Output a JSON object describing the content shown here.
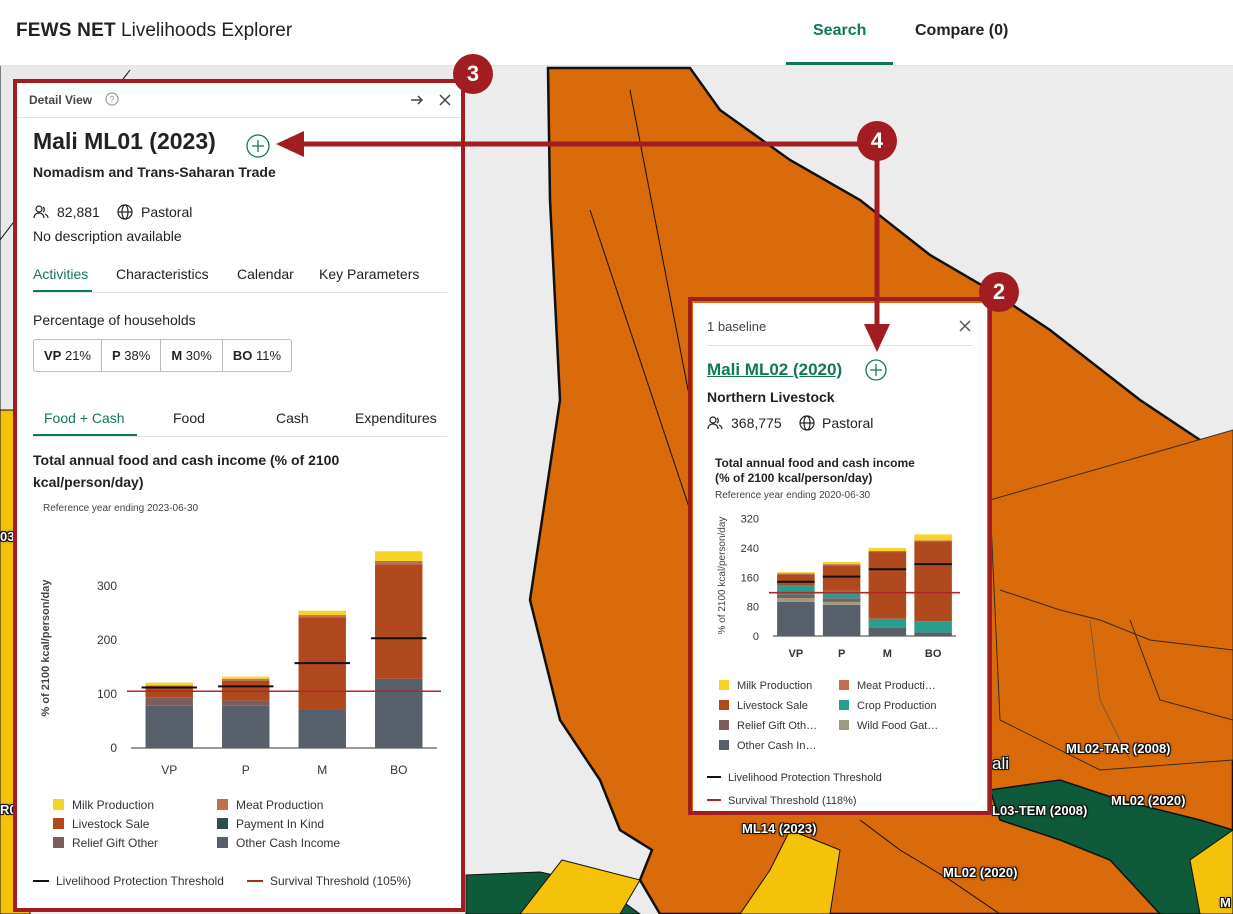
{
  "header": {
    "brand_bold": "FEWS NET",
    "brand_rest": "Livelihoods Explorer",
    "nav_search": "Search",
    "nav_compare": "Compare (0)"
  },
  "colors": {
    "accent_green": "#0f7a4f",
    "annotation_red": "#a11d22",
    "map_orange": "#d96b0b",
    "map_yellow": "#f5c20a",
    "map_dark_green": "#0e5a3a",
    "milk": "#f5d327",
    "livestock_sale": "#b04a1e",
    "meat": "#c07050",
    "crop": "#2a9d8f",
    "relief": "#7d5c5c",
    "wild_food": "#9c9a80",
    "payment_in_kind": "#2f4f4f",
    "other_cash": "#57606a",
    "survival_line": "#b1262b",
    "lpt_line": "#111111"
  },
  "annotations": {
    "badge3": "3",
    "badge4": "4",
    "badge2": "2"
  },
  "map_labels": {
    "ml02_tar": "ML02-TAR (2008)",
    "ml02_a": "ML02 (2020)",
    "ml02_b": "ML02 (2020)",
    "ml03_tem": "L03-TEM (2008)",
    "ml14": "ML14 (2023)",
    "mali": "ali",
    "edge_03": "03",
    "edge_r0": "R0",
    "edge_m": "M"
  },
  "detail": {
    "header_label": "Detail View",
    "title": "Mali ML01 (2023)",
    "subtitle": "Nomadism and Trans-Saharan Trade",
    "population": "82,881",
    "type": "Pastoral",
    "description": "No description available",
    "tabs": [
      "Activities",
      "Characteristics",
      "Calendar",
      "Key Parameters"
    ],
    "pct_label": "Percentage of households",
    "pcts": [
      {
        "group": "VP",
        "value": "21%"
      },
      {
        "group": "P",
        "value": "38%"
      },
      {
        "group": "M",
        "value": "30%"
      },
      {
        "group": "BO",
        "value": "11%"
      }
    ],
    "subtabs": [
      "Food + Cash",
      "Food",
      "Cash",
      "Expenditures"
    ],
    "chart_title": "Total annual food and cash income (% of 2100 kcal/person/day)",
    "ref_year": "Reference year ending 2023-06-30",
    "legend": {
      "milk": "Milk Production",
      "meat": "Meat Production",
      "livestock": "Livestock Sale",
      "pik": "Payment In Kind",
      "relief": "Relief Gift Other",
      "other_cash": "Other Cash Income",
      "lpt": "Livelihood Protection Threshold",
      "survival": "Survival Threshold (105%)"
    }
  },
  "compare": {
    "header_label": "1 baseline",
    "title": "Mali ML02 (2020)",
    "subtitle": "Northern Livestock",
    "population": "368,775",
    "type": "Pastoral",
    "chart_title_1": "Total annual food and cash income",
    "chart_title_2": "(% of 2100 kcal/person/day)",
    "ref_year": "Reference year ending 2020-06-30",
    "legend": {
      "milk": "Milk Production",
      "meat": "Meat Producti…",
      "livestock": "Livestock Sale",
      "crop": "Crop Production",
      "relief": "Relief Gift Oth…",
      "wild": "Wild Food Gat…",
      "other_cash": "Other Cash In…",
      "lpt": "Livelihood Protection Threshold",
      "survival": "Survival Threshold (118%)"
    }
  },
  "chart_data": [
    {
      "type": "bar",
      "stacked": true,
      "title": "Total annual food and cash income (% of 2100 kcal/person/day)",
      "subtitle": "Reference year ending 2023-06-30",
      "ylabel": "% of 2100 kcal/person/day",
      "xlabel": "",
      "categories": [
        "VP",
        "P",
        "M",
        "BO"
      ],
      "ylim": [
        0,
        370
      ],
      "yticks": [
        0,
        100,
        200,
        300
      ],
      "series": [
        {
          "name": "Other Cash Income",
          "color": "#57606a",
          "values": [
            78,
            78,
            72,
            128
          ]
        },
        {
          "name": "Payment In Kind",
          "color": "#2f4f4f",
          "values": [
            0,
            0,
            0,
            0
          ]
        },
        {
          "name": "Relief Gift Other",
          "color": "#7d5c5c",
          "values": [
            16,
            10,
            0,
            0
          ]
        },
        {
          "name": "Livestock Sale",
          "color": "#b04a1e",
          "values": [
            18,
            36,
            170,
            212
          ]
        },
        {
          "name": "Meat Production",
          "color": "#c07050",
          "values": [
            4,
            4,
            4,
            6
          ]
        },
        {
          "name": "Milk Production",
          "color": "#f5d327",
          "values": [
            5,
            4,
            8,
            18
          ]
        }
      ],
      "livelihood_protection_threshold": [
        112,
        114,
        157,
        203
      ],
      "survival_threshold": 105
    },
    {
      "type": "bar",
      "stacked": true,
      "title": "Total annual food and cash income (% of 2100 kcal/person/day)",
      "subtitle": "Reference year ending 2020-06-30",
      "ylabel": "% of 2100 kcal/person/day",
      "xlabel": "",
      "categories": [
        "VP",
        "P",
        "M",
        "BO"
      ],
      "ylim": [
        0,
        330
      ],
      "yticks": [
        0,
        80,
        160,
        240,
        320
      ],
      "series": [
        {
          "name": "Other Cash Income",
          "color": "#57606a",
          "values": [
            93,
            85,
            22,
            10
          ]
        },
        {
          "name": "Wild Food Gathering",
          "color": "#9c9a80",
          "values": [
            10,
            8,
            0,
            0
          ]
        },
        {
          "name": "Relief Gift Other",
          "color": "#7d5c5c",
          "values": [
            10,
            10,
            0,
            0
          ]
        },
        {
          "name": "Crop Production",
          "color": "#2a9d8f",
          "values": [
            25,
            20,
            25,
            30
          ]
        },
        {
          "name": "Livestock Sale",
          "color": "#b04a1e",
          "values": [
            30,
            70,
            182,
            218
          ]
        },
        {
          "name": "Meat Production",
          "color": "#c07050",
          "values": [
            3,
            3,
            3,
            3
          ]
        },
        {
          "name": "Milk Production",
          "color": "#f5d327",
          "values": [
            3,
            6,
            8,
            16
          ]
        }
      ],
      "livelihood_protection_threshold": [
        148,
        162,
        182,
        196
      ],
      "survival_threshold": 118
    }
  ]
}
